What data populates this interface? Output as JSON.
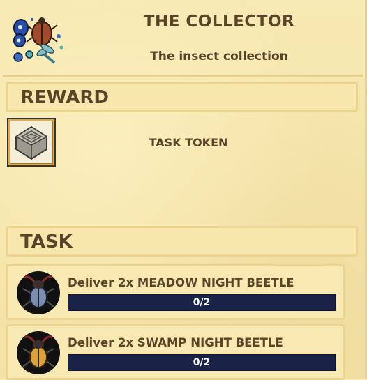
{
  "header": {
    "title": "THE COLLECTOR",
    "subtitle": "The insect collection",
    "icon": "insect-collection-icon"
  },
  "reward": {
    "section_label": "REWARD",
    "item_label": "TASK TOKEN",
    "icon": "task-token-icon"
  },
  "task": {
    "section_label": "TASK",
    "items": [
      {
        "label": "Deliver 2x MEADOW NIGHT BEETLE",
        "progress_text": "0/2",
        "progress": 0,
        "icon": "meadow-night-beetle-icon",
        "beetle_color": "#7a8fb0"
      },
      {
        "label": "Deliver 2x SWAMP NIGHT BEETLE",
        "progress_text": "0/2",
        "progress": 0,
        "icon": "swamp-night-beetle-icon",
        "beetle_color": "#d9a33a"
      }
    ]
  },
  "colors": {
    "parchment": "#f6e7b0",
    "text": "#5a4428",
    "progress_bg": "#1a2347",
    "token_frame": "#e8a93a"
  }
}
